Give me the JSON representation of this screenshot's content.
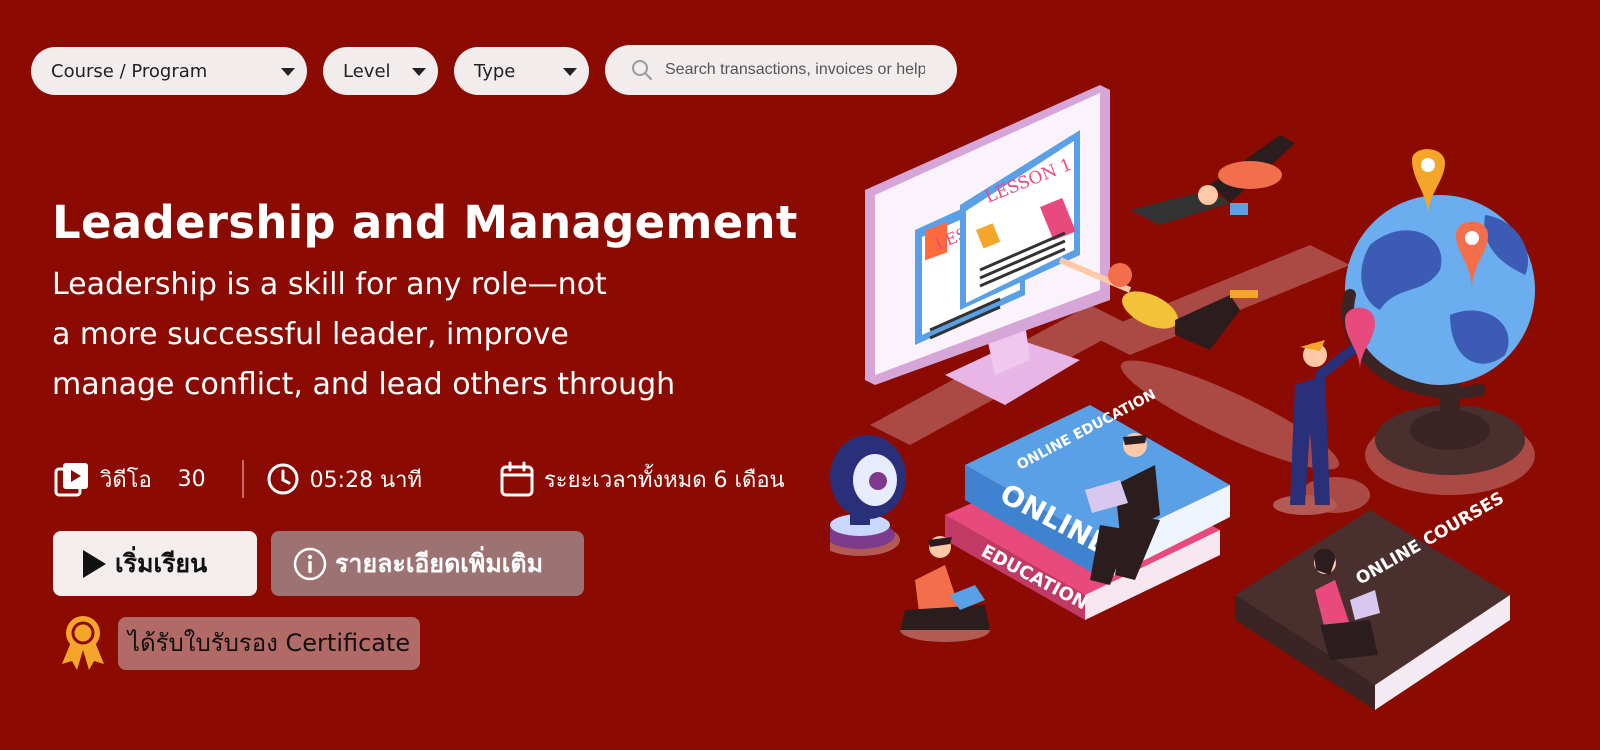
{
  "filters": {
    "course_program": "Course / Program",
    "level": "Level",
    "type": "Type"
  },
  "search": {
    "placeholder": "Search transactions, invoices or help"
  },
  "course": {
    "title": "Leadership and Management",
    "description_lines": [
      "Leadership is a skill for any role—not",
      "a more successful leader, improve",
      "manage conflict, and lead others through"
    ]
  },
  "stats": {
    "video_label": "วิดีโอ",
    "video_count": "30",
    "duration": "05:28 นาที",
    "total_period": "ระยะเวลาทั้งหมด 6 เดือน"
  },
  "actions": {
    "start_label": "เริ่มเรียน",
    "details_label": "รายละเอียดเพิ่มเติม"
  },
  "certificate": {
    "label": "ได้รับใบรับรอง Certificate"
  },
  "illustration": {
    "monitor_lesson": "LESSON 1",
    "monitor_lesson_back": "LES",
    "book_blue_top": "ONLINE EDUCATION",
    "book_blue_spine": "ONLINE",
    "book_pink_spine": "EDUCATION",
    "book_dark_top": "ONLINE COURSES"
  },
  "colors": {
    "background": "#8b0a02",
    "pill": "#f2ecec",
    "details_button": "#9c7372",
    "certificate_badge": "#b26a67",
    "medal": "#f4a62a"
  }
}
